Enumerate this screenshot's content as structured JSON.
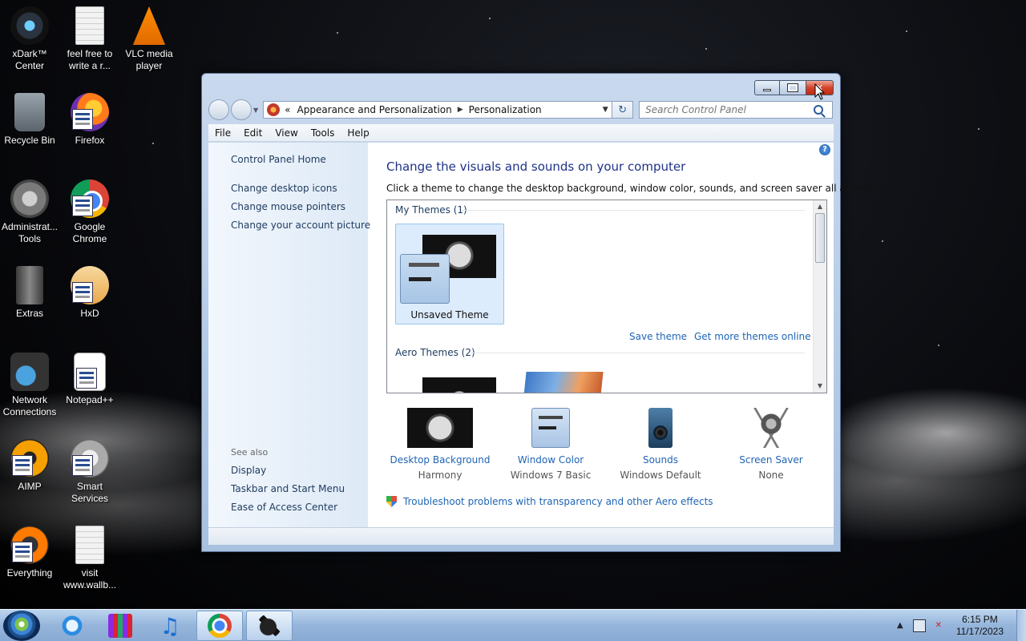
{
  "desktop": {
    "icons": [
      {
        "label": "xDark™ Center",
        "icon": "xdark-icon"
      },
      {
        "label": "feel free to write a r...",
        "icon": "text-document-icon"
      },
      {
        "label": "VLC media player",
        "icon": "vlc-cone-icon"
      },
      {
        "label": "Recycle Bin",
        "icon": "recycle-bin-icon"
      },
      {
        "label": "Firefox",
        "icon": "firefox-icon"
      },
      {
        "label": "Administrat... Tools",
        "icon": "admin-tools-icon"
      },
      {
        "label": "Google Chrome",
        "icon": "chrome-icon"
      },
      {
        "label": "Extras",
        "icon": "folder-icon"
      },
      {
        "label": "HxD",
        "icon": "hxd-icon"
      },
      {
        "label": "Network Connections",
        "icon": "network-icon"
      },
      {
        "label": "Notepad++",
        "icon": "notepad-plus-plus-icon"
      },
      {
        "label": "AIMP",
        "icon": "aimp-icon"
      },
      {
        "label": "Smart Services",
        "icon": "smart-services-icon"
      },
      {
        "label": "Everything",
        "icon": "everything-search-icon"
      },
      {
        "label": "visit www.wallb...",
        "icon": "text-document-icon"
      }
    ]
  },
  "window": {
    "caption": {
      "minimize": "minimize",
      "maximize": "maximize",
      "close": "✕"
    },
    "address": {
      "chevron": "«",
      "crumbs": [
        "Appearance and Personalization",
        "Personalization"
      ],
      "separator": "▶",
      "dropdown": "▼",
      "refresh": "↻"
    },
    "search": {
      "placeholder": "Search Control Panel"
    },
    "menu": [
      "File",
      "Edit",
      "View",
      "Tools",
      "Help"
    ],
    "left_pane": {
      "home": "Control Panel Home",
      "tasks": [
        "Change desktop icons",
        "Change mouse pointers",
        "Change your account picture"
      ],
      "see_also_heading": "See also",
      "see_also": [
        "Display",
        "Taskbar and Start Menu",
        "Ease of Access Center"
      ]
    },
    "main": {
      "help": "?",
      "title": "Change the visuals and sounds on your computer",
      "description": "Click a theme to change the desktop background, window color, sounds, and screen saver all at once.",
      "my_themes_heading": "My Themes (1)",
      "selected_theme": "Unsaved Theme",
      "save_theme": "Save theme",
      "get_more_themes": "Get more themes online",
      "aero_themes_heading": "Aero Themes (2)",
      "settings": [
        {
          "name": "Desktop Background",
          "value": "Harmony"
        },
        {
          "name": "Window Color",
          "value": "Windows 7 Basic"
        },
        {
          "name": "Sounds",
          "value": "Windows Default"
        },
        {
          "name": "Screen Saver",
          "value": "None"
        }
      ],
      "troubleshoot": "Troubleshoot problems with transparency and other Aero effects"
    }
  },
  "taskbar": {
    "items": [
      "internet-explorer-icon",
      "winrar-archive-icon",
      "music-note-icon",
      "chrome-icon",
      "personalization-icon"
    ],
    "clock": {
      "time": "6:15 PM",
      "date": "11/17/2023"
    },
    "tray": {
      "show_hidden": "▲"
    }
  }
}
